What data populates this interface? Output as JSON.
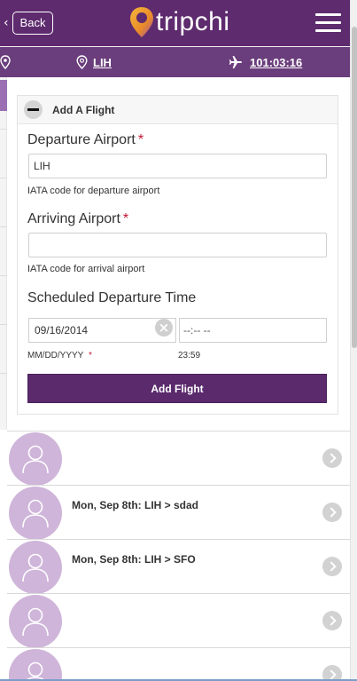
{
  "header": {
    "back_label": "Back",
    "logo_text": "tripchi",
    "menu_icon": "hamburger-icon"
  },
  "subbar": {
    "airport": "LIH",
    "flight_time": "101:03:16",
    "airport_icon": "map-pin-icon",
    "flight_icon": "airplane-icon"
  },
  "form": {
    "title": "Add A Flight",
    "departure": {
      "label": "Departure Airport",
      "value": "LIH",
      "hint": "IATA code for departure airport"
    },
    "arrival": {
      "label": "Arriving Airport",
      "value": "",
      "hint": "IATA code for arrival airport"
    },
    "schedule": {
      "label": "Scheduled Departure Time",
      "date_value": "09/16/2014",
      "time_value": "--:-- --",
      "date_format": "MM/DD/YYYY",
      "time_hint": "23:59"
    },
    "required_mark": "*",
    "submit_label": "Add Flight"
  },
  "colors": {
    "brand_purple": "#5e2b6e",
    "subbar_purple": "#6a3d7c",
    "avatar_lilac": "#cfb5da",
    "logo_orange": "#f0a232",
    "required_red": "#c0152f"
  },
  "trips": [
    {
      "title": ""
    },
    {
      "title": "Mon, Sep 8th: LIH > sdad"
    },
    {
      "title": "Mon, Sep 8th: LIH > SFO"
    },
    {
      "title": ""
    },
    {
      "title": ""
    }
  ]
}
